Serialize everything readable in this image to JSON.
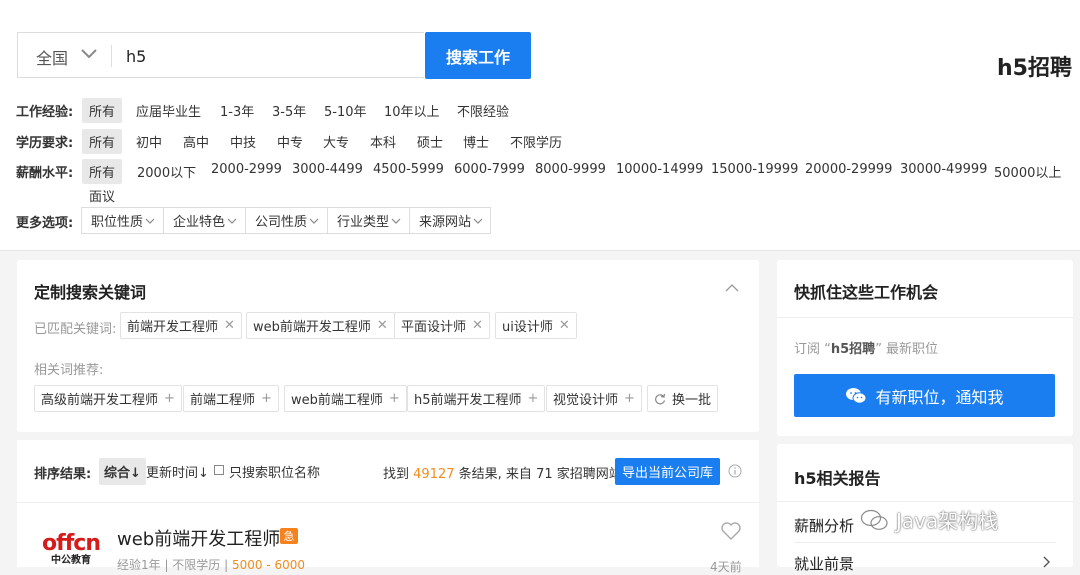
{
  "search": {
    "city": "全国",
    "query": "h5",
    "button": "搜索工作"
  },
  "page_title": "h5招聘",
  "filters": {
    "experience": {
      "label": "工作经验:",
      "options": [
        "所有",
        "应届毕业生",
        "1-3年",
        "3-5年",
        "5-10年",
        "10年以上",
        "不限经验"
      ]
    },
    "education": {
      "label": "学历要求:",
      "options": [
        "所有",
        "初中",
        "高中",
        "中技",
        "中专",
        "大专",
        "本科",
        "硕士",
        "博士",
        "不限学历"
      ]
    },
    "salary": {
      "label": "薪酬水平:",
      "options": [
        "所有",
        "2000以下",
        "2000-2999",
        "3000-4499",
        "4500-5999",
        "6000-7999",
        "8000-9999",
        "10000-14999",
        "15000-19999",
        "20000-29999",
        "30000-49999",
        "50000以上",
        "面议"
      ]
    },
    "more": {
      "label": "更多选项:",
      "options": [
        "职位性质",
        "企业特色",
        "公司性质",
        "行业类型",
        "来源网站"
      ]
    }
  },
  "keywords": {
    "title": "定制搜索关键词",
    "matched_label": "已匹配关键词:",
    "matched": [
      "前端开发工程师",
      "web前端开发工程师",
      "平面设计师",
      "ui设计师"
    ],
    "related_label": "相关词推荐:",
    "related": [
      "高级前端开发工程师",
      "前端工程师",
      "web前端工程师",
      "h5前端开发工程师",
      "视觉设计师"
    ],
    "refresh": "换一批"
  },
  "sort": {
    "label": "排序结果:",
    "options": [
      "综合",
      "更新时间"
    ],
    "checkbox_label": "只搜索职位名称",
    "result_prefix": "找到",
    "result_count": "49127",
    "result_middle": "条结果, 来自",
    "source_count": "71",
    "result_suffix": "家招聘网站",
    "export": "导出当前公司库"
  },
  "job": {
    "title": "web前端开发工程师",
    "urgent": "急",
    "company_logo": "offcn",
    "company_logo_sub": "中公教育",
    "meta_prefix": "经验1年 | 不限学历 |",
    "salary": "5000 - 6000",
    "time": "4天前"
  },
  "side": {
    "opportunity_title": "快抓住这些工作机会",
    "subscribe_prefix": "订阅 “",
    "subscribe_keyword": "h5招聘",
    "subscribe_suffix": "” 最新职位",
    "notify_button": "有新职位，通知我",
    "report_title": "h5相关报告",
    "reports": [
      "薪酬分析",
      "就业前景"
    ]
  },
  "watermark": "Java架构栈",
  "colors": {
    "accent": "#1a7ef0",
    "highlight": "#f08c1e",
    "urgent": "#f5821f"
  }
}
